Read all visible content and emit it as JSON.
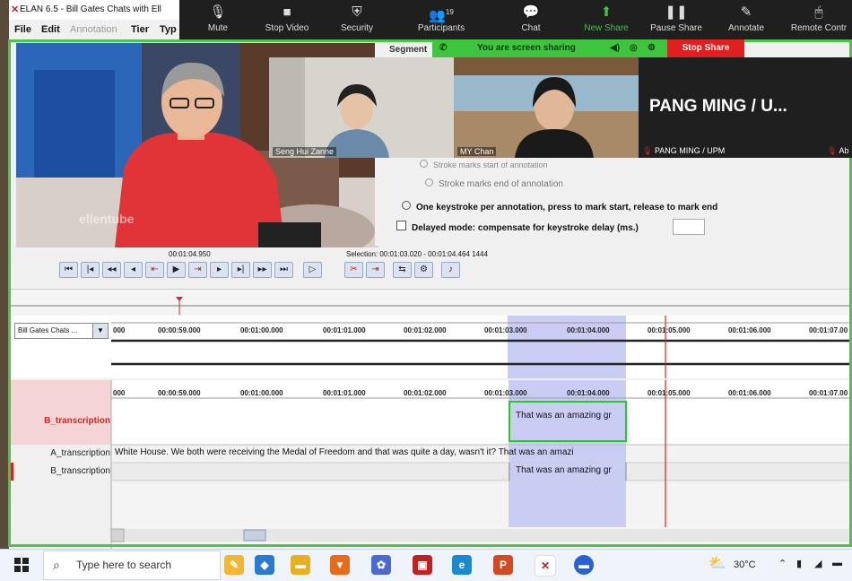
{
  "elan": {
    "title": "ELAN 6.5 - Bill Gates Chats with Ell",
    "menu": [
      "File",
      "Edit",
      "Annotation",
      "Tier",
      "Typ"
    ],
    "media_time": "00:01:04.950",
    "selection": "Selection: 00:01:03.020 - 00:01:04.464  1444",
    "wave_combo": "Bill Gates Chats ...",
    "ticks": [
      "000",
      "00:00:59.000",
      "00:01:00.000",
      "00:01:01.000",
      "00:01:02.000",
      "00:01:03.000",
      "00:01:04.000",
      "00:01:05.000",
      "00:01:06.000",
      "00:01:07.00"
    ],
    "options": {
      "opt1": "Stroke marks start of annotation",
      "opt2": "Stroke marks end of annotation",
      "opt3": "One keystroke per annotation, press to mark start, release to mark end",
      "opt4": "Delayed mode: compensate for keystroke delay (ms.)",
      "partial_tab": "Segment"
    },
    "tiers": {
      "active_name": "B_transcription",
      "active_annotation": "That was an amazing gr",
      "a_name": "A_transcription",
      "a_annotation": "White House. We both were receiving the Medal of Freedom and that was quite a day, wasn't it? That was an amazi",
      "b_name": "B_transcription",
      "b_annotation": "That was an amazing gr"
    },
    "watermark": "ellentube"
  },
  "zoom": {
    "toolbar": [
      {
        "label": "Mute",
        "icon": "mic-icon"
      },
      {
        "label": "Stop Video",
        "icon": "video-icon"
      },
      {
        "label": "Security",
        "icon": "shield-icon"
      },
      {
        "label": "Participants",
        "icon": "participants-icon",
        "count": "19"
      },
      {
        "label": "Chat",
        "icon": "chat-icon"
      },
      {
        "label": "New Share",
        "icon": "share-icon"
      },
      {
        "label": "Pause Share",
        "icon": "pause-icon"
      },
      {
        "label": "Annotate",
        "icon": "pencil-icon"
      },
      {
        "label": "Remote Contr",
        "icon": "mouse-icon"
      }
    ],
    "banner": "You are screen sharing",
    "stop_share": "Stop Share",
    "participants": [
      {
        "name": "Seng Hui Zanne"
      },
      {
        "name": "MY Chan"
      },
      {
        "name": "PANG MING / UPM",
        "big_name": "PANG MING / U..."
      },
      {
        "name": "Ab"
      }
    ]
  },
  "taskbar": {
    "search_placeholder": "Type here to search",
    "temperature": "30°C"
  },
  "colors": {
    "zoom_green": "#3ec43e",
    "stop_red": "#e02020",
    "selection_blue": "#c9cdf4",
    "crosshair_red": "#e02020",
    "active_tier_red": "#e02020"
  }
}
